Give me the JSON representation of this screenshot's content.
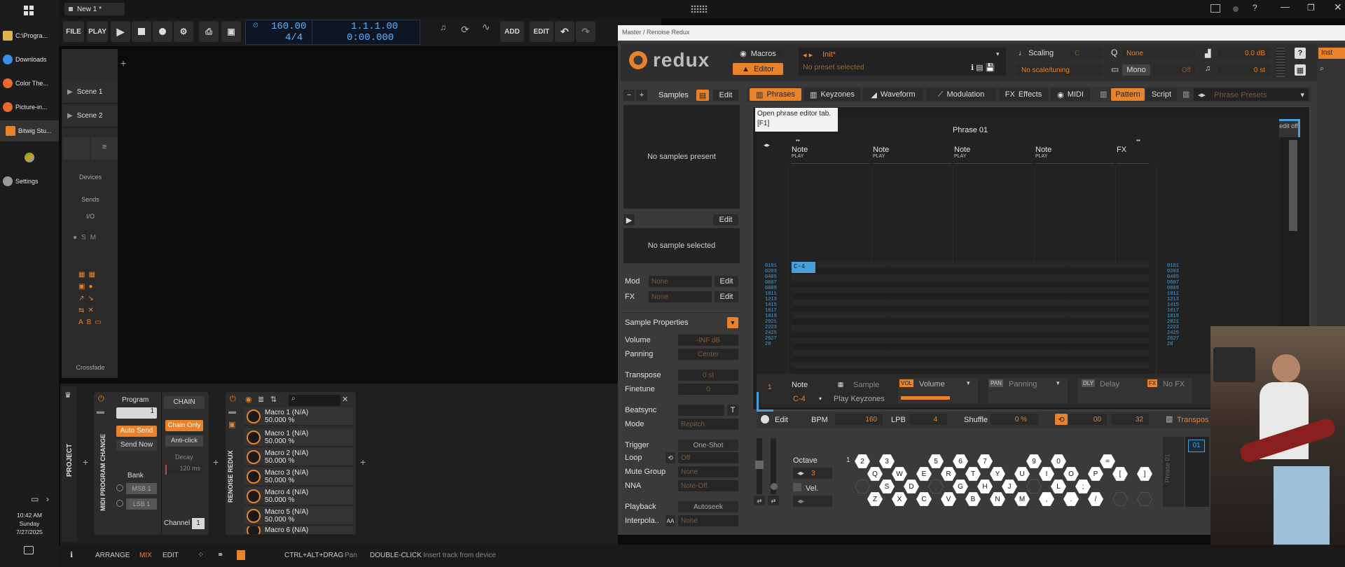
{
  "taskbar": {
    "items": [
      "C:\\Progra...",
      "Downloads",
      "Color The...",
      "Picture-in...",
      "Bitwig Stu...",
      "",
      "Settings"
    ],
    "clock": {
      "time": "10:42 AM",
      "day": "Sunday",
      "date": "7/27/2025"
    }
  },
  "topbar": {
    "tab": "New 1 *"
  },
  "transport": {
    "file": "FILE",
    "play": "PLAY",
    "tempo": "160.00",
    "signature": "4/4",
    "position": "1.1.1.00",
    "time": "0:00.000",
    "add": "ADD",
    "edit": "EDIT"
  },
  "scenes": [
    "Scene 1",
    "Scene 2"
  ],
  "side_labels": [
    "Devices",
    "Sends",
    "I/O",
    "Crossfade"
  ],
  "project_label": "PROJECT",
  "midi_pc": {
    "title": "MIDI PROGRAM CHANGE",
    "program_label": "Program",
    "program_value": "1",
    "auto_send": "Auto Send",
    "send_now": "Send Now",
    "bank_label": "Bank",
    "msb": "MSB 1",
    "lsb": "LSB 1",
    "chain": "CHAIN",
    "chain_only": "Chain Only",
    "anti_click": "Anti-click",
    "decay_label": "Decay",
    "decay_value": "120 ms",
    "channel_label": "Channel",
    "channel_value": "1"
  },
  "renoise": {
    "title": "RENOISE REDUX",
    "macros": [
      {
        "name": "Macro 1 (N/A)",
        "value": "50.000 %"
      },
      {
        "name": "Macro 1 (N/A)",
        "value": "50.000 %"
      },
      {
        "name": "Macro 2 (N/A)",
        "value": "50.000 %"
      },
      {
        "name": "Macro 3 (N/A)",
        "value": "50.000 %"
      },
      {
        "name": "Macro 4 (N/A)",
        "value": "50.000 %"
      },
      {
        "name": "Macro 5 (N/A)",
        "value": "50.000 %"
      },
      {
        "name": "Macro 6 (N/A)",
        "value": ""
      }
    ]
  },
  "redux": {
    "window_title": "Master / Renoise Redux",
    "logo": "redux",
    "macros_btn": "Macros",
    "editor_btn": "Editor",
    "preset_name": "Init*",
    "preset_status": "No preset selected",
    "scaling_label": "Scaling",
    "scaling_key": "C",
    "scale_value": "No scale/tuning",
    "quantize": "None",
    "mono": "Mono",
    "mono_value": "Off",
    "volume": "0.0 dB",
    "transpose": "0 st",
    "samples_label": "Samples",
    "edit": "Edit",
    "no_samples": "No samples present",
    "no_sample_selected": "No sample selected",
    "mod_label": "Mod",
    "mod_value": "None",
    "fx_label": "FX",
    "fx_value": "None",
    "sample_properties": "Sample Properties",
    "props": [
      {
        "label": "Volume",
        "value": "-INF dB"
      },
      {
        "label": "Panning",
        "value": "Center"
      },
      {
        "label": "Transpose",
        "value": "0 st"
      },
      {
        "label": "Finetune",
        "value": "0"
      },
      {
        "label": "Beatsync",
        "value": ""
      },
      {
        "label": "Mode",
        "value": "Repitch"
      },
      {
        "label": "Trigger",
        "value": "One-Shot"
      },
      {
        "label": "Loop",
        "value": "Off"
      },
      {
        "label": "Mute Group",
        "value": "None"
      },
      {
        "label": "NNA",
        "value": "Note-Off"
      },
      {
        "label": "Playback",
        "value": "Autoseek"
      },
      {
        "label": "Interpola..",
        "value": "None"
      }
    ],
    "tabs": [
      "Phrases",
      "Keyzones",
      "Waveform",
      "Modulation",
      "Effects",
      "MIDI"
    ],
    "pattern": "Pattern",
    "script": "Script",
    "phrase_presets": "Phrase Presets",
    "tooltip_line1": "Open phrase editor tab.",
    "tooltip_line2": "[F1]",
    "phrase_title": "Phrase 01",
    "edit_off": "edit off",
    "columns": [
      "Note",
      "Note",
      "Note",
      "Note",
      "FX"
    ],
    "column_sub": "PLAY",
    "first_note": "C-4",
    "note_label": "Note",
    "note_value": "C-4",
    "sample_label": "Sample",
    "play_keyzones": "Play Keyzones",
    "vol": "VOL",
    "volume_label": "Volume",
    "pan": "PAN",
    "panning_label": "Panning",
    "dly": "DLY",
    "delay_label": "Delay",
    "fx": "FX",
    "no_fx": "No FX",
    "row_num": "1",
    "bpm_label": "BPM",
    "bpm": "160",
    "lpb_label": "LPB",
    "lpb": "4",
    "shuffle_label": "Shuffle",
    "shuffle": "0 %",
    "loop_start": "00",
    "loop_end": "32",
    "transpose_btn": "Transpos",
    "octave_label": "Octave",
    "octave": "3",
    "vel_label": "Vel.",
    "phrase_side": "Phrase 01",
    "phrase_num": "01",
    "keys_top": [
      "2",
      "3",
      "5",
      "6",
      "7",
      "9",
      "0",
      "="
    ],
    "keys_q": [
      "Q",
      "W",
      "E",
      "R",
      "T",
      "Y",
      "U",
      "I",
      "O",
      "P",
      "[",
      "]"
    ],
    "keys_a": [
      "S",
      "D",
      "G",
      "H",
      "J",
      "L",
      ";"
    ],
    "keys_z": [
      "Z",
      "X",
      "C",
      "V",
      "B",
      "N",
      "M",
      ",",
      ".",
      "/"
    ]
  },
  "bottom": {
    "arrange": "ARRANGE",
    "mix": "MIX",
    "edit": "EDIT",
    "hint1_key": "CTRL+ALT+DRAG",
    "hint1": "Pan",
    "hint2_key": "DOUBLE-CLICK",
    "hint2": "Insert track from device"
  },
  "colors": {
    "accent": "#e8832b",
    "lcd": "#5fb3ff",
    "selected": "#4a9fd8"
  }
}
